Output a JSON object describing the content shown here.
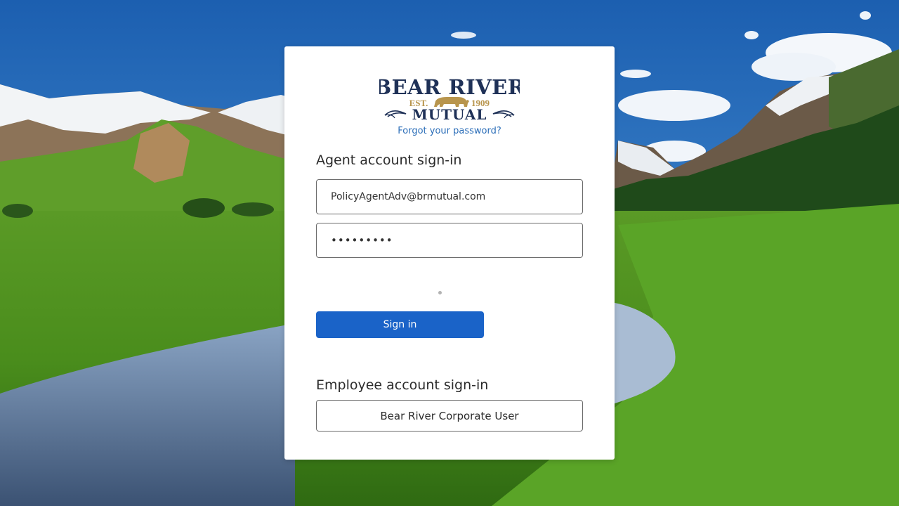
{
  "logo": {
    "line1": "BEAR RIVER",
    "est": "EST.",
    "year": "1909",
    "line2": "MUTUAL",
    "colors": {
      "navy": "#1f3157",
      "gold": "#b8954d"
    }
  },
  "forgot_password": "Forgot your password?",
  "agent": {
    "heading": "Agent account sign-in",
    "email_value": "PolicyAgentAdv@brmutual.com",
    "password_value": "•••••••••",
    "signin_label": "Sign in"
  },
  "employee": {
    "heading": "Employee account sign-in",
    "corporate_label": "Bear River Corporate User"
  },
  "colors": {
    "accent": "#1a63c8",
    "link": "#2a6db8"
  }
}
